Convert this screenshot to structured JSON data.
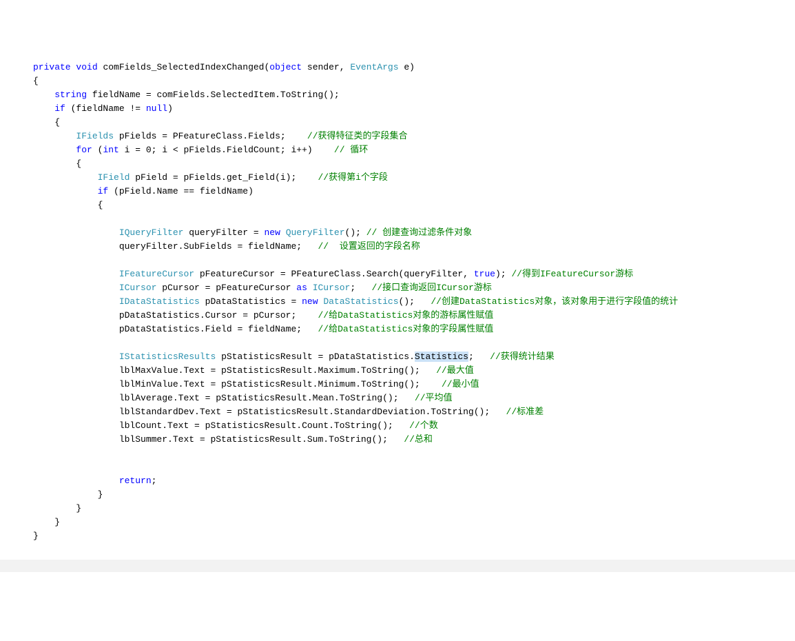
{
  "kw": {
    "private": "private",
    "void": "void",
    "object": "object",
    "string": "string",
    "if": "if",
    "null": "null",
    "for": "for",
    "int": "int",
    "new": "new",
    "as": "as",
    "true": "true",
    "return": "return"
  },
  "types": {
    "EventArgs": "EventArgs",
    "IFields": "IFields",
    "IField": "IField",
    "IQueryFilter": "IQueryFilter",
    "QueryFilter": "QueryFilter",
    "IFeatureCursor": "IFeatureCursor",
    "ICursor": "ICursor",
    "IDataStatistics": "IDataStatistics",
    "DataStatistics": "DataStatistics",
    "IStatisticsResults": "IStatisticsResults"
  },
  "code": {
    "method_sig": " comFields_SelectedIndexChanged(",
    "sender": " sender, ",
    "e_param": " e)",
    "brace_open": "{",
    "brace_close": "}",
    "fieldName_decl": " fieldName = comFields.SelectedItem.ToString();",
    "if_cond": " (fieldName != ",
    "if_close": ")",
    "pFields_decl": " pFields = PFeatureClass.Fields;    ",
    "for_open": " (",
    "for_init": " i = 0; i < pFields.FieldCount; i++)    ",
    "pField_decl": " pField = pFields.get_Field(i);    ",
    "if_name": " (pField.Name == fieldName)",
    "queryFilter_decl": " queryFilter = ",
    "queryFilter_new": "(); ",
    "subFields": "queryFilter.SubFields = fieldName;   ",
    "pFeatureCursor_decl": " pFeatureCursor = PFeatureClass.Search(queryFilter, ",
    "pFeatureCursor_end": "); ",
    "pCursor_decl": " pCursor = pFeatureCursor ",
    "pCursor_end": ";   ",
    "pDataStats_decl": " pDataStatistics = ",
    "pDataStats_end": "();   ",
    "cursor_assign": "pDataStatistics.Cursor = pCursor;    ",
    "field_assign": "pDataStatistics.Field = fieldName;   ",
    "statsResult_decl": " pStatisticsResult = pDataStatistics.",
    "statistics_word": "Statistics",
    "statsResult_end": ";   ",
    "lblMax": "lblMaxValue.Text = pStatisticsResult.Maximum.ToString();   ",
    "lblMin": "lblMinValue.Text = pStatisticsResult.Minimum.ToString();    ",
    "lblAvg": "lblAverage.Text = pStatisticsResult.Mean.ToString();   ",
    "lblStd": "lblStandardDev.Text = pStatisticsResult.StandardDeviation.ToString();   ",
    "lblCount": "lblCount.Text = pStatisticsResult.Count.ToString();   ",
    "lblSum": "lblSummer.Text = pStatisticsResult.Sum.ToString();   ",
    "return_stmt": ";"
  },
  "comments": {
    "c1": "//获得特征类的字段集合",
    "c2": "// 循环",
    "c3": "//获得第i个字段",
    "c4": "// 创建查询过滤条件对象",
    "c5": "//  设置返回的字段名称",
    "c6": "//得到IFeatureCursor游标",
    "c7": "//接口查询返回ICursor游标",
    "c8": "//创建DataStatistics对象，该对象用于进行字段值的统计",
    "c9": "//给DataStatistics对象的游标属性赋值",
    "c10": "//给DataStatistics对象的字段属性赋值",
    "c11": "//获得统计结果",
    "c12": "//最大值",
    "c13": "//最小值",
    "c14": "//平均值",
    "c15": "//标准差",
    "c16": "//个数",
    "c17": "//总和"
  }
}
